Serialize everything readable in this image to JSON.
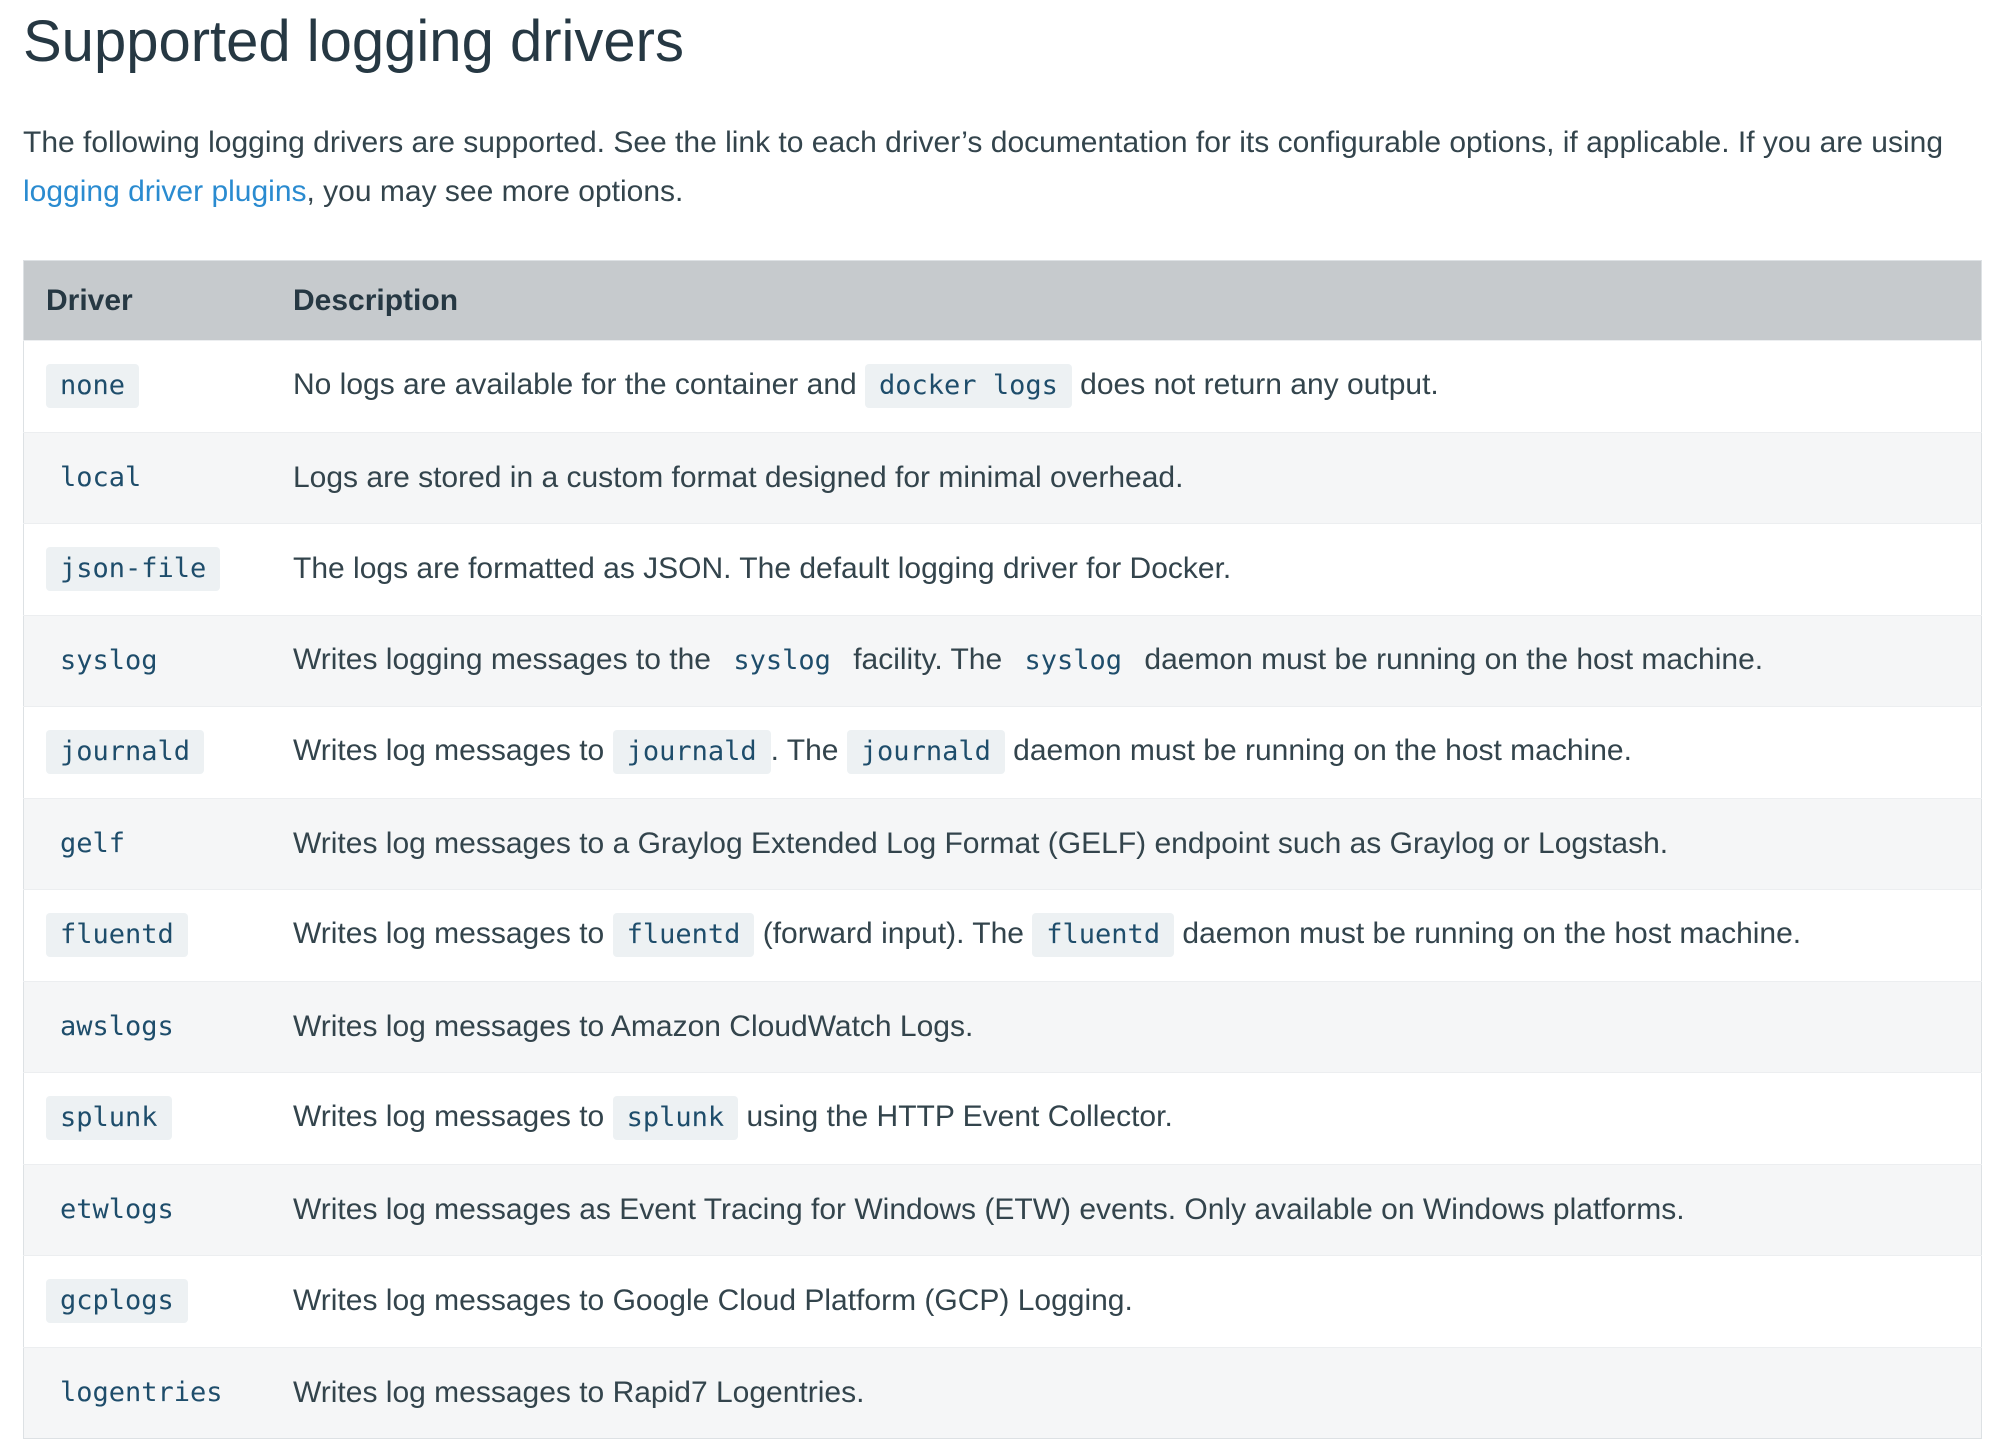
{
  "page": {
    "title": "Supported logging drivers",
    "intro_before_link": "The following logging drivers are supported. See the link to each driver’s documentation for its configurable options, if applicable. If you are using ",
    "intro_link": "logging driver plugins",
    "intro_after_link": ", you may see more options."
  },
  "table": {
    "headers": {
      "driver": "Driver",
      "description": "Description"
    },
    "rows": [
      {
        "driver": "none",
        "desc": [
          {
            "t": "No logs are available for the container and "
          },
          {
            "c": "docker logs"
          },
          {
            "t": " does not return any output."
          }
        ]
      },
      {
        "driver": "local",
        "desc": [
          {
            "t": "Logs are stored in a custom format designed for minimal overhead."
          }
        ]
      },
      {
        "driver": "json-file",
        "desc": [
          {
            "t": "The logs are formatted as JSON. The default logging driver for Docker."
          }
        ]
      },
      {
        "driver": "syslog",
        "desc": [
          {
            "t": "Writes logging messages to the "
          },
          {
            "c": "syslog"
          },
          {
            "t": " facility. The "
          },
          {
            "c": "syslog"
          },
          {
            "t": " daemon must be running on the host machine."
          }
        ]
      },
      {
        "driver": "journald",
        "desc": [
          {
            "t": "Writes log messages to "
          },
          {
            "c": "journald"
          },
          {
            "t": ". The "
          },
          {
            "c": "journald"
          },
          {
            "t": " daemon must be running on the host machine."
          }
        ]
      },
      {
        "driver": "gelf",
        "desc": [
          {
            "t": "Writes log messages to a Graylog Extended Log Format (GELF) endpoint such as Graylog or Logstash."
          }
        ]
      },
      {
        "driver": "fluentd",
        "desc": [
          {
            "t": "Writes log messages to "
          },
          {
            "c": "fluentd"
          },
          {
            "t": " (forward input). The "
          },
          {
            "c": "fluentd"
          },
          {
            "t": " daemon must be running on the host machine."
          }
        ]
      },
      {
        "driver": "awslogs",
        "desc": [
          {
            "t": "Writes log messages to Amazon CloudWatch Logs."
          }
        ]
      },
      {
        "driver": "splunk",
        "desc": [
          {
            "t": "Writes log messages to "
          },
          {
            "c": "splunk"
          },
          {
            "t": " using the HTTP Event Collector."
          }
        ]
      },
      {
        "driver": "etwlogs",
        "desc": [
          {
            "t": "Writes log messages as Event Tracing for Windows (ETW) events. Only available on Windows platforms."
          }
        ]
      },
      {
        "driver": "gcplogs",
        "desc": [
          {
            "t": "Writes log messages to Google Cloud Platform (GCP) Logging."
          }
        ]
      },
      {
        "driver": "logentries",
        "desc": [
          {
            "t": "Writes log messages to Rapid7 Logentries."
          }
        ]
      }
    ]
  }
}
